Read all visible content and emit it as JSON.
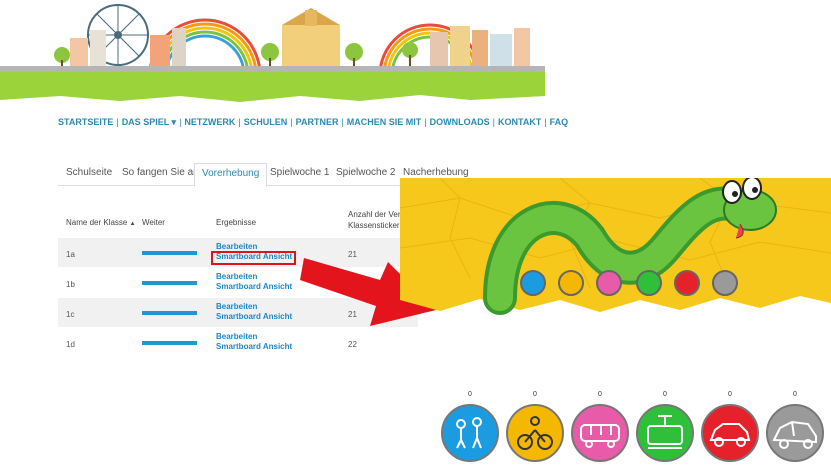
{
  "nav": {
    "items": [
      "STARTSEITE",
      "DAS SPIEL ▾",
      "NETZWERK",
      "SCHULEN",
      "PARTNER",
      "MACHEN SIE MIT",
      "DOWNLOADS",
      "KONTAKT",
      "FAQ"
    ]
  },
  "tabs": [
    "Schulseite",
    "So fangen Sie an",
    "Vorerhebung",
    "Spielwoche 1",
    "Spielwoche 2",
    "Nacherhebung"
  ],
  "active_tab": "Vorerhebung",
  "table": {
    "headers": {
      "name": "Name der Klasse",
      "sort_icon": "▲",
      "weiter": "Weiter",
      "ergebnisse": "Ergebnisse",
      "anzahl_line1": "Anzahl der Verkeh",
      "anzahl_line2": "Klassensticker ber"
    },
    "rows": [
      {
        "name": "1a",
        "edit": "Bearbeiten",
        "smart": "Smartboard Ansicht",
        "count": "21"
      },
      {
        "name": "1b",
        "edit": "Bearbeiten",
        "smart": "Smartboard Ansicht",
        "count": ""
      },
      {
        "name": "1c",
        "edit": "Bearbeiten",
        "smart": "Smartboard Ansicht",
        "count": "21"
      },
      {
        "name": "1d",
        "edit": "Bearbeiten",
        "smart": "Smartboard Ansicht",
        "count": "22"
      }
    ]
  },
  "tokens": [
    {
      "icon": "walking-children-icon",
      "color": "#1b9be0",
      "count": "0"
    },
    {
      "icon": "bicycle-icon",
      "color": "#f5b800",
      "count": "0"
    },
    {
      "icon": "bus-icon",
      "color": "#e85ba8",
      "count": "0"
    },
    {
      "icon": "tram-icon",
      "color": "#2fbf3a",
      "count": "0"
    },
    {
      "icon": "car-icon",
      "color": "#e5222b",
      "count": "0"
    },
    {
      "icon": "parent-taxi-icon",
      "color": "#9a9a9a",
      "count": "0"
    }
  ],
  "colors": {
    "link": "#1d86c9",
    "highlight": "#d9161d",
    "snake_bg": "#f7c81c",
    "grass": "#9ad33a"
  }
}
